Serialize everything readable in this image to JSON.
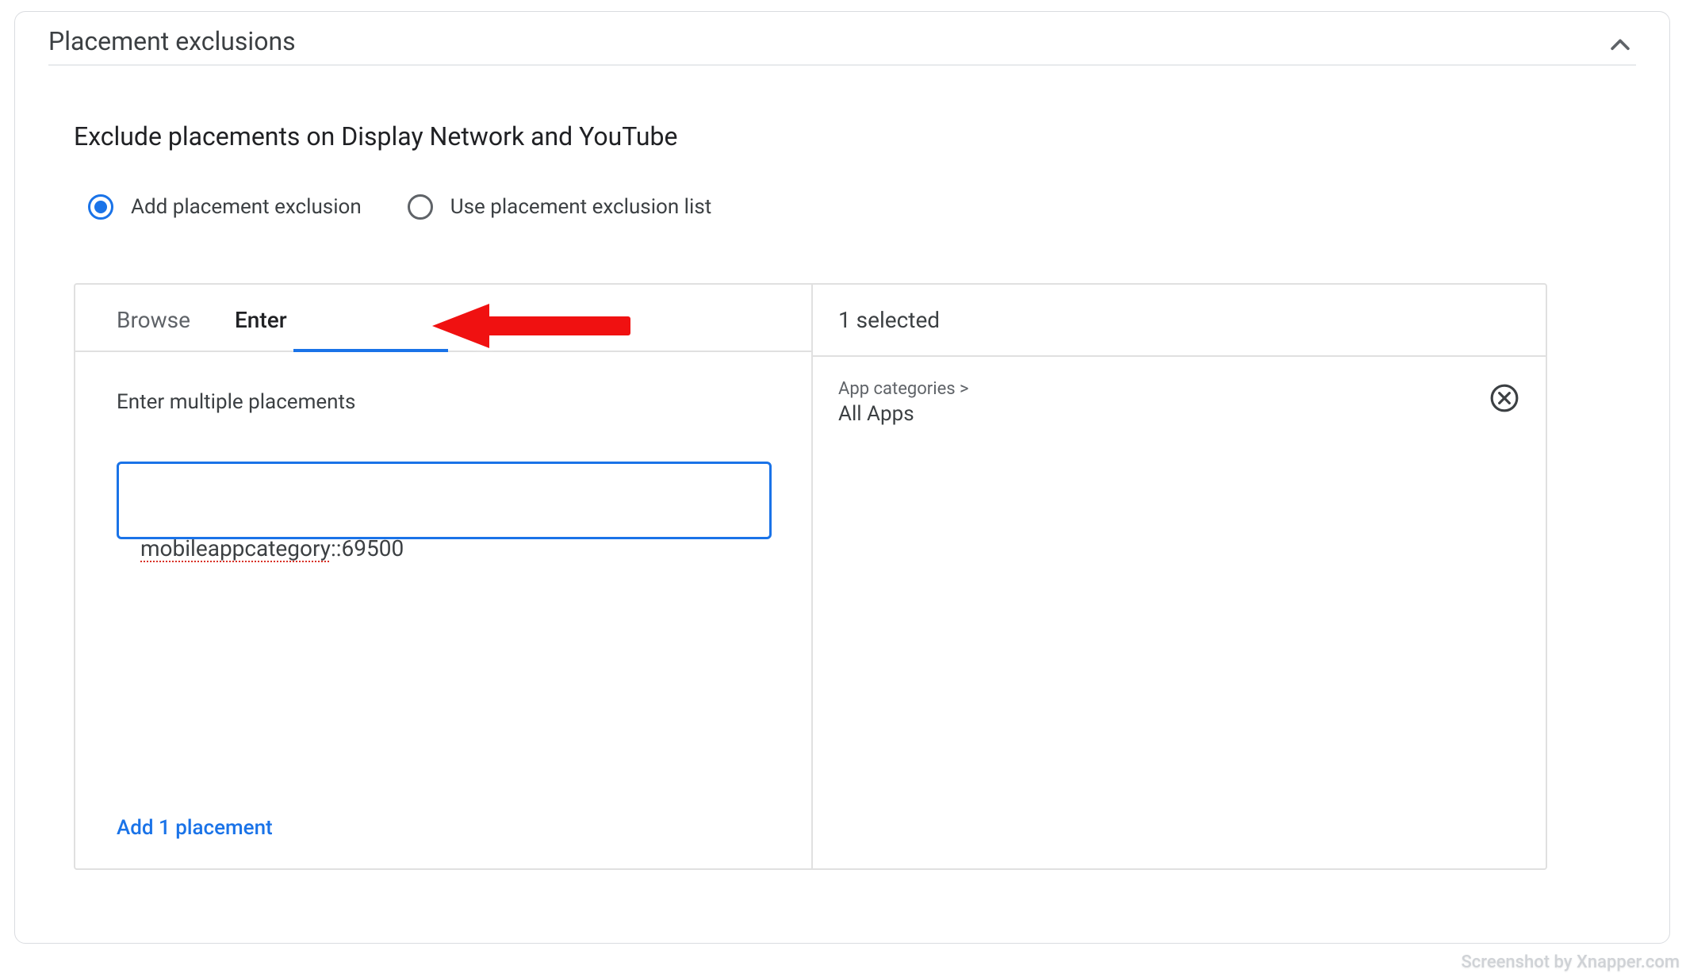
{
  "section": {
    "title": "Placement exclusions",
    "subtitle": "Exclude placements on Display Network and YouTube"
  },
  "radios": {
    "add": "Add placement exclusion",
    "use_list": "Use placement exclusion list"
  },
  "tabs": {
    "browse": "Browse",
    "enter": "Enter"
  },
  "enter_panel": {
    "label": "Enter multiple placements",
    "input_value": "mobileappcategory::69500",
    "input_underlined_part": "mobileappcategory",
    "input_rest": "::69500",
    "add_link": "Add 1 placement"
  },
  "selected_panel": {
    "count_label": "1 selected",
    "items": [
      {
        "breadcrumb": "App categories >",
        "name": "All Apps"
      }
    ]
  },
  "watermark": "Screenshot by Xnapper.com"
}
